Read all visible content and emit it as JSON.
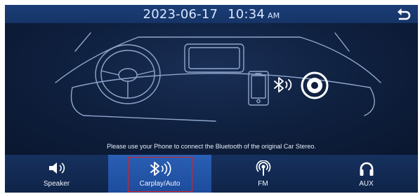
{
  "status": {
    "date": "2023-06-17",
    "time": "10:34",
    "ampm": "AM"
  },
  "icons": {
    "back": "back-arrow-icon",
    "speaker": "speaker-icon",
    "bluetooth": "bluetooth-icon",
    "fm": "fm-radio-icon",
    "aux": "headphones-icon"
  },
  "main": {
    "hint": "Please use your Phone to connect the Bluetooth of the original Car Stereo."
  },
  "nav": {
    "speaker": "Speaker",
    "carplay": "Carplay/Auto",
    "fm": "FM",
    "aux": "AUX",
    "active": "Carplay/Auto"
  },
  "colors": {
    "background": "#0b1a33",
    "bar": "#163466",
    "active_tab": "#2a5fb5",
    "highlight": "#e02020"
  }
}
